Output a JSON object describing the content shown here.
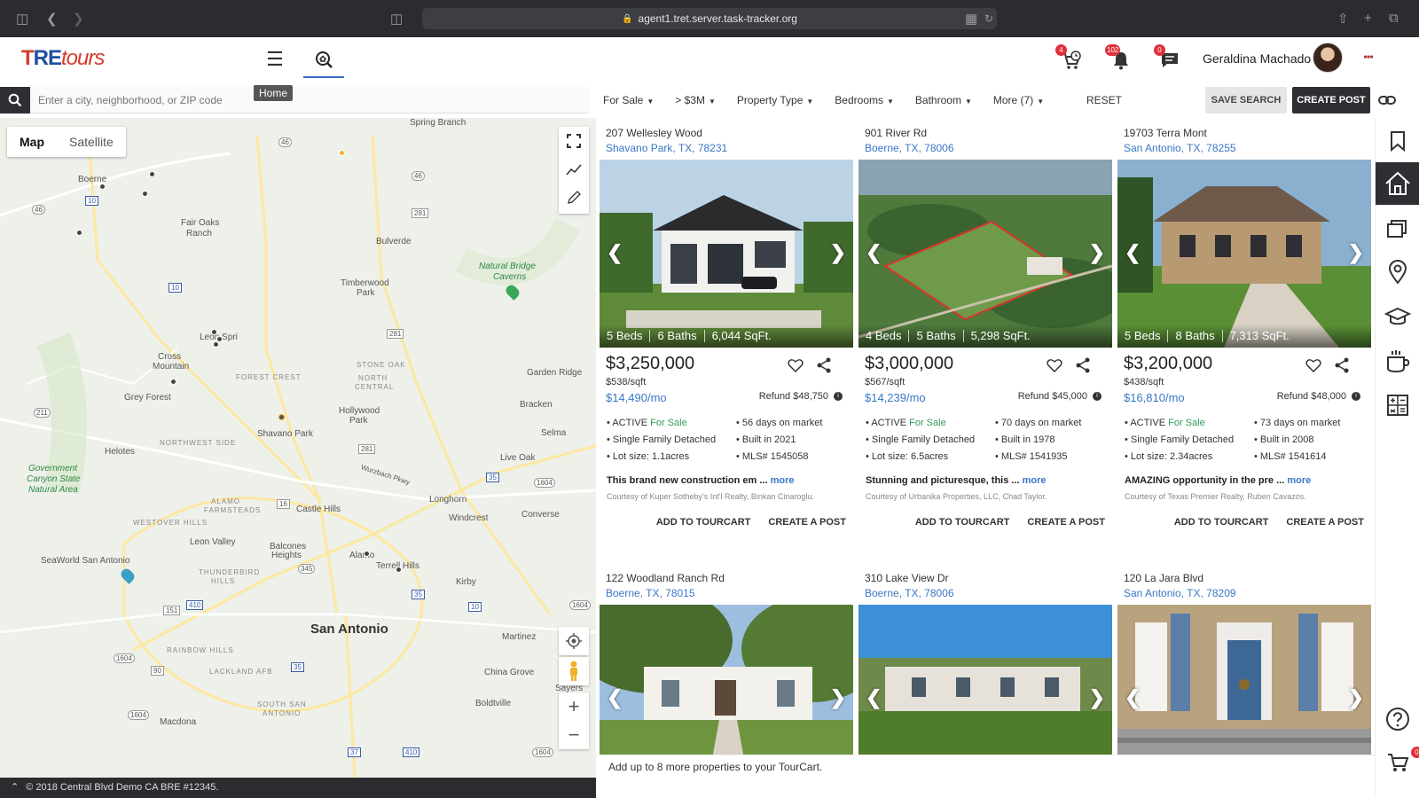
{
  "browser": {
    "url": "agent1.tret.server.task-tracker.org"
  },
  "app": {
    "logo_t": "T",
    "logo_re": "RE",
    "logo_tours": "tours",
    "home_tooltip": "Home"
  },
  "header": {
    "tour_badge": "4",
    "notif_badge": "102",
    "msg_badge": "0",
    "user_name": "Geraldina Machado"
  },
  "search": {
    "placeholder": "Enter a city, neighborhood, or ZIP code"
  },
  "filters": {
    "sale": "For Sale",
    "price": "> $3M",
    "property_type": "Property Type",
    "bedrooms": "Bedrooms",
    "bathroom": "Bathroom",
    "more": "More (7)",
    "reset": "RESET",
    "save_search": "SAVE SEARCH",
    "create_post": "CREATE POST"
  },
  "map": {
    "toggle_map": "Map",
    "toggle_satellite": "Satellite",
    "labels": {
      "spring_branch": "Spring Branch",
      "boerne": "Boerne",
      "fair_oaks": "Fair Oaks",
      "ranch": "Ranch",
      "bulverde": "Bulverde",
      "natural_bridge": "Natural Bridge",
      "caverns": "Caverns",
      "timberwood": "Timberwood",
      "park": "Park",
      "leon_springs": "Leon Spri",
      "cross": "Cross",
      "mountain": "Mountain",
      "stone_oak": "STONE OAK",
      "north_central": "NORTH",
      "central": "CENTRAL",
      "garden_ridge": "Garden Ridge",
      "grey_forest": "Grey Forest",
      "forest_crest": "FOREST CREST",
      "hollywood": "Hollywood",
      "hollywood_park": "Park",
      "bracken": "Bracken",
      "shavano_park": "Shavano Park",
      "selma": "Selma",
      "helotes": "Helotes",
      "northwest_side": "NORTHWEST SIDE",
      "live_oak": "Live Oak",
      "government": "Government",
      "canyon_state": "Canyon State",
      "natural_area": "Natural Area",
      "wurzbach": "Wurzbach Pkwy",
      "longhorn": "Longhorn",
      "alamo_farmsteads": "ALAMO",
      "farmsteads": "FARMSTEADS",
      "castle_hills": "Castle Hills",
      "windcrest": "Windcrest",
      "converse": "Converse",
      "westover_hills": "WESTOVER HILLS",
      "leon_valley": "Leon Valley",
      "seaworld": "SeaWorld San Antonio",
      "balcones": "Balcones",
      "heights": "Heights",
      "alamo_heights": "Alamo",
      "terrell_hills": "Terrell Hills",
      "kirby": "Kirby",
      "thunderbird": "THUNDERBIRD",
      "hills": "HILLS",
      "san_antonio": "San Antonio",
      "martinez": "Martinez",
      "rainbow_hills": "RAINBOW HILLS",
      "lackland": "LACKLAND AFB",
      "south_san": "SOUTH SAN",
      "antonio": "ANTONIO",
      "china_grove": "China Grove",
      "sayers": "Sayers",
      "boldtville": "Boldtville",
      "macdona": "Macdona",
      "r46": "46",
      "r10a": "10",
      "r46b": "46",
      "r281": "281",
      "r10b": "10",
      "r281b": "281",
      "r211": "211",
      "r281c": "281",
      "r35": "35",
      "r1604a": "1604",
      "r16": "16",
      "r151": "151",
      "r410": "410",
      "r345": "345",
      "r35b": "35",
      "r10c": "10",
      "r1604b": "1604",
      "r90": "90",
      "r1604c": "1604",
      "r1604d": "1604",
      "r35c": "35",
      "r37": "37",
      "r1604e": "1604",
      "r410b": "410"
    },
    "copyright": "© 2018 Central Blvd Demo CA BRE #12345."
  },
  "listings": [
    {
      "addr1": "207 Wellesley Wood",
      "addr2": "Shavano Park, TX, 78231",
      "beds": "5 Beds",
      "baths": "6 Baths",
      "sqft": "6,044 SqFt.",
      "price": "$3,250,000",
      "ppsf": "$538/sqft",
      "monthly": "$14,490/mo",
      "refund": "Refund $48,750",
      "status": "ACTIVE",
      "sale": "For Sale",
      "dom": "56 days on market",
      "type": "Single Family Detached",
      "built": "Built in 2021",
      "lot": "Lot size: 1.1acres",
      "mls": "MLS# 1545058",
      "desc": "This brand new construction em ... ",
      "more": "more",
      "courtesy": "Courtesy of Kuper Sotheby's Int'l Realty, Binkan Cinaroglu.",
      "add_cart": "ADD TO TOURCART",
      "create_post": "CREATE A POST"
    },
    {
      "addr1": "901 River Rd",
      "addr2": "Boerne, TX, 78006",
      "beds": "4 Beds",
      "baths": "5 Baths",
      "sqft": "5,298 SqFt.",
      "price": "$3,000,000",
      "ppsf": "$567/sqft",
      "monthly": "$14,239/mo",
      "refund": "Refund $45,000",
      "status": "ACTIVE",
      "sale": "For Sale",
      "dom": "70 days on market",
      "type": "Single Family Detached",
      "built": "Built in 1978",
      "lot": "Lot size: 6.5acres",
      "mls": "MLS# 1541935",
      "desc": "Stunning and picturesque, this ... ",
      "more": "more",
      "courtesy": "Courtesy of Urbanika Properties, LLC, Chad Taylor.",
      "add_cart": "ADD TO TOURCART",
      "create_post": "CREATE A POST"
    },
    {
      "addr1": "19703 Terra Mont",
      "addr2": "San Antonio, TX, 78255",
      "beds": "5 Beds",
      "baths": "8 Baths",
      "sqft": "7,313 SqFt.",
      "price": "$3,200,000",
      "ppsf": "$438/sqft",
      "monthly": "$16,810/mo",
      "refund": "Refund $48,000",
      "status": "ACTIVE",
      "sale": "For Sale",
      "dom": "73 days on market",
      "type": "Single Family Detached",
      "built": "Built in 2008",
      "lot": "Lot size: 2.34acres",
      "mls": "MLS# 1541614",
      "desc": "AMAZING opportunity in the pre ... ",
      "more": "more",
      "courtesy": "Courtesy of Texas Premier Realty, Ruben Cavazos.",
      "add_cart": "ADD TO TOURCART",
      "create_post": "CREATE A POST"
    },
    {
      "addr1": "122 Woodland Ranch Rd",
      "addr2": "Boerne, TX, 78015"
    },
    {
      "addr1": "310 Lake View Dr",
      "addr2": "Boerne, TX, 78006"
    },
    {
      "addr1": "120 La Jara Blvd",
      "addr2": "San Antonio, TX, 78209"
    }
  ],
  "tourcart": {
    "message": "Add up to 8 more properties to your TourCart.",
    "badge": "0"
  },
  "colors": {
    "accent_blue": "#3a77c5",
    "badge_red": "#e0303a",
    "dark": "#2e2e33",
    "active_green": "#2e9d57"
  }
}
